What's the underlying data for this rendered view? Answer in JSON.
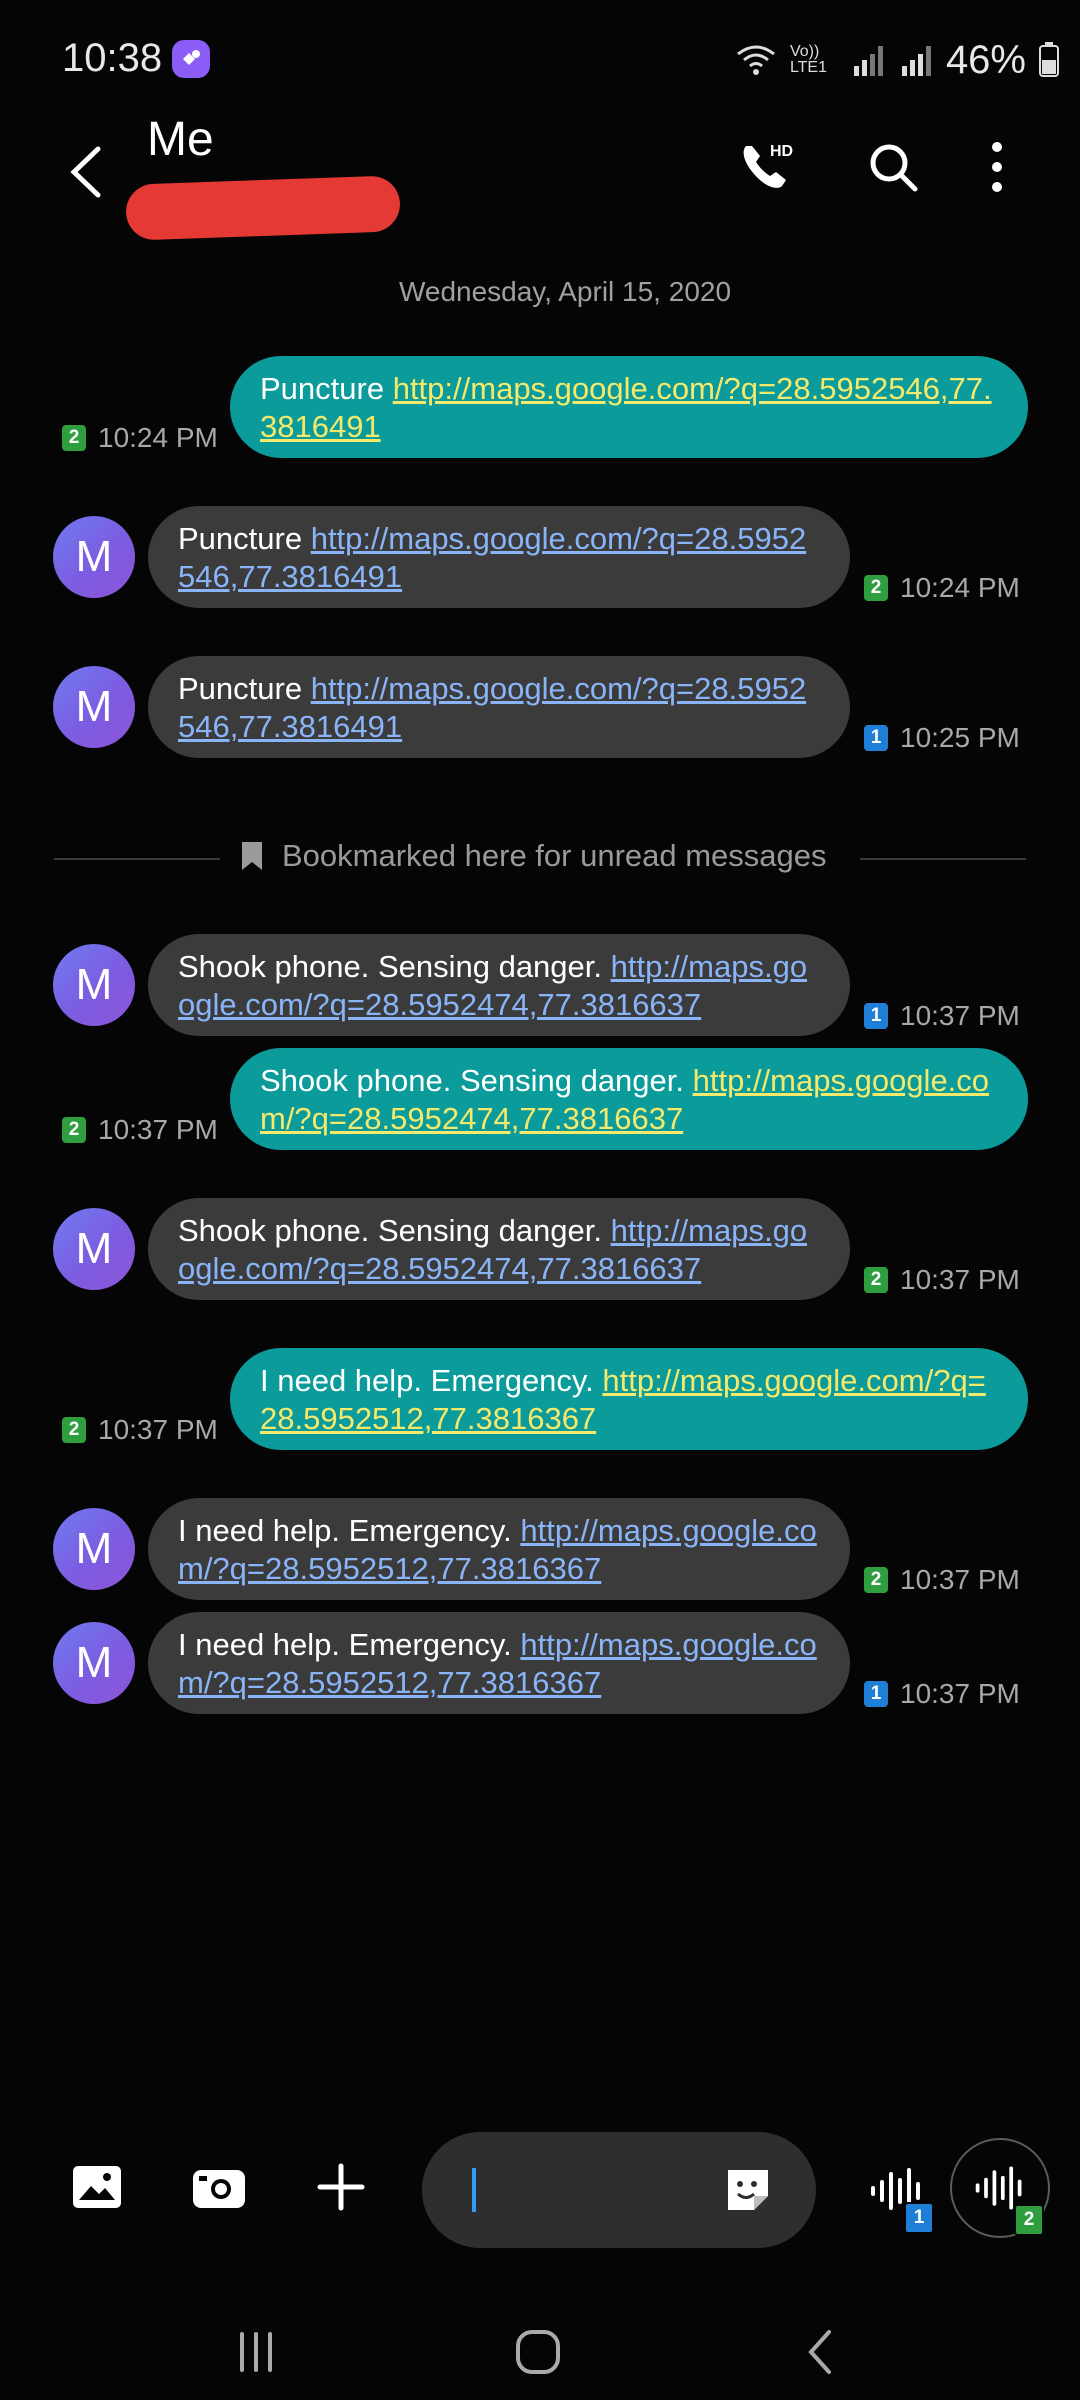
{
  "status": {
    "time": "10:38",
    "battery": "46%",
    "signal_label": "Vo)) LTE1"
  },
  "header": {
    "contact_name": "Me"
  },
  "date_header": "Wednesday, April 15, 2020",
  "bookmark_text": "Bookmarked here for unread messages",
  "avatar_letter": "M",
  "messages": [
    {
      "dir": "out",
      "text": "Puncture ",
      "link": "http://maps.google.com/?q=28.5952546,77.3816491",
      "time": "10:24 PM",
      "sim": "2"
    },
    {
      "dir": "in",
      "text": "Puncture ",
      "link": "http://maps.google.com/?q=28.5952546,77.3816491",
      "time": "10:24 PM",
      "sim": "2"
    },
    {
      "dir": "in",
      "text": "Puncture ",
      "link": "http://maps.google.com/?q=28.5952546,77.3816491",
      "time": "10:25 PM",
      "sim": "1"
    },
    {
      "dir": "in",
      "text": "Shook phone. Sensing danger. ",
      "link": "http://maps.google.com/?q=28.5952474,77.3816637",
      "time": "10:37 PM",
      "sim": "1"
    },
    {
      "dir": "out",
      "text": "Shook phone. Sensing danger. ",
      "link": "http://maps.google.com/?q=28.5952474,77.3816637",
      "time": "10:37 PM",
      "sim": "2"
    },
    {
      "dir": "in",
      "text": "Shook phone. Sensing danger. ",
      "link": "http://maps.google.com/?q=28.5952474,77.3816637",
      "time": "10:37 PM",
      "sim": "2"
    },
    {
      "dir": "out",
      "text": "I need help. Emergency. ",
      "link": "http://maps.google.com/?q=28.5952512,77.3816367",
      "time": "10:37 PM",
      "sim": "2"
    },
    {
      "dir": "in",
      "text": "I need help. Emergency. ",
      "link": "http://maps.google.com/?q=28.5952512,77.3816367",
      "time": "10:37 PM",
      "sim": "2"
    },
    {
      "dir": "in",
      "text": "I need help. Emergency. ",
      "link": "http://maps.google.com/?q=28.5952512,77.3816367",
      "time": "10:37 PM",
      "sim": "1"
    }
  ],
  "composer": {
    "input_value": "",
    "voice_sim_1": "1",
    "voice_sim_2": "2"
  },
  "colors": {
    "outgoing_bubble": "#0a9b9a",
    "incoming_bubble": "#3b3b3b",
    "incoming_link": "#8ab4f8",
    "outgoing_link": "#f5e96b",
    "sim1": "#1f7ed6",
    "sim2": "#2e9e3f"
  },
  "icons": [
    "back-arrow-icon",
    "hd-call-icon",
    "search-icon",
    "more-vertical-icon",
    "bookmark-icon",
    "gallery-icon",
    "camera-icon",
    "plus-icon",
    "sticker-icon",
    "voice-wave-icon",
    "recents-icon",
    "home-icon",
    "back-nav-icon"
  ]
}
